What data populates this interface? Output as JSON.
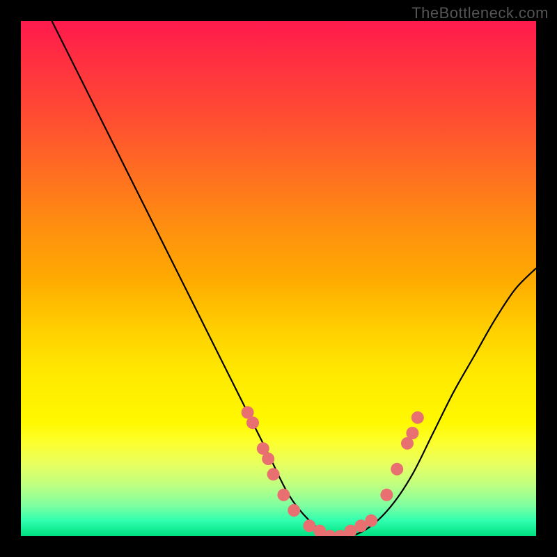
{
  "watermark": "TheBottleneck.com",
  "chart_data": {
    "type": "line",
    "title": "",
    "xlabel": "",
    "ylabel": "",
    "xlim": [
      0,
      100
    ],
    "ylim": [
      0,
      100
    ],
    "series": [
      {
        "name": "bottleneck-curve",
        "x": [
          6,
          12,
          18,
          24,
          30,
          36,
          40,
          44,
          48,
          52,
          56,
          60,
          64,
          68,
          72,
          76,
          80,
          84,
          88,
          92,
          96,
          100
        ],
        "y": [
          100,
          88,
          76,
          64,
          52,
          40,
          32,
          24,
          16,
          8,
          3,
          0,
          0,
          2,
          6,
          12,
          20,
          28,
          35,
          42,
          48,
          52
        ]
      }
    ],
    "markers": {
      "name": "highlight-dots",
      "color": "#e87070",
      "points": [
        {
          "x": 44,
          "y": 24
        },
        {
          "x": 45,
          "y": 22
        },
        {
          "x": 47,
          "y": 17
        },
        {
          "x": 48,
          "y": 15
        },
        {
          "x": 49,
          "y": 12
        },
        {
          "x": 51,
          "y": 8
        },
        {
          "x": 53,
          "y": 5
        },
        {
          "x": 56,
          "y": 2
        },
        {
          "x": 58,
          "y": 1
        },
        {
          "x": 60,
          "y": 0
        },
        {
          "x": 62,
          "y": 0
        },
        {
          "x": 64,
          "y": 1
        },
        {
          "x": 66,
          "y": 2
        },
        {
          "x": 68,
          "y": 3
        },
        {
          "x": 71,
          "y": 8
        },
        {
          "x": 73,
          "y": 13
        },
        {
          "x": 75,
          "y": 18
        },
        {
          "x": 76,
          "y": 20
        },
        {
          "x": 77,
          "y": 23
        }
      ]
    },
    "background_gradient": {
      "top": "#ff1a4d",
      "bottom": "#00e080"
    }
  }
}
